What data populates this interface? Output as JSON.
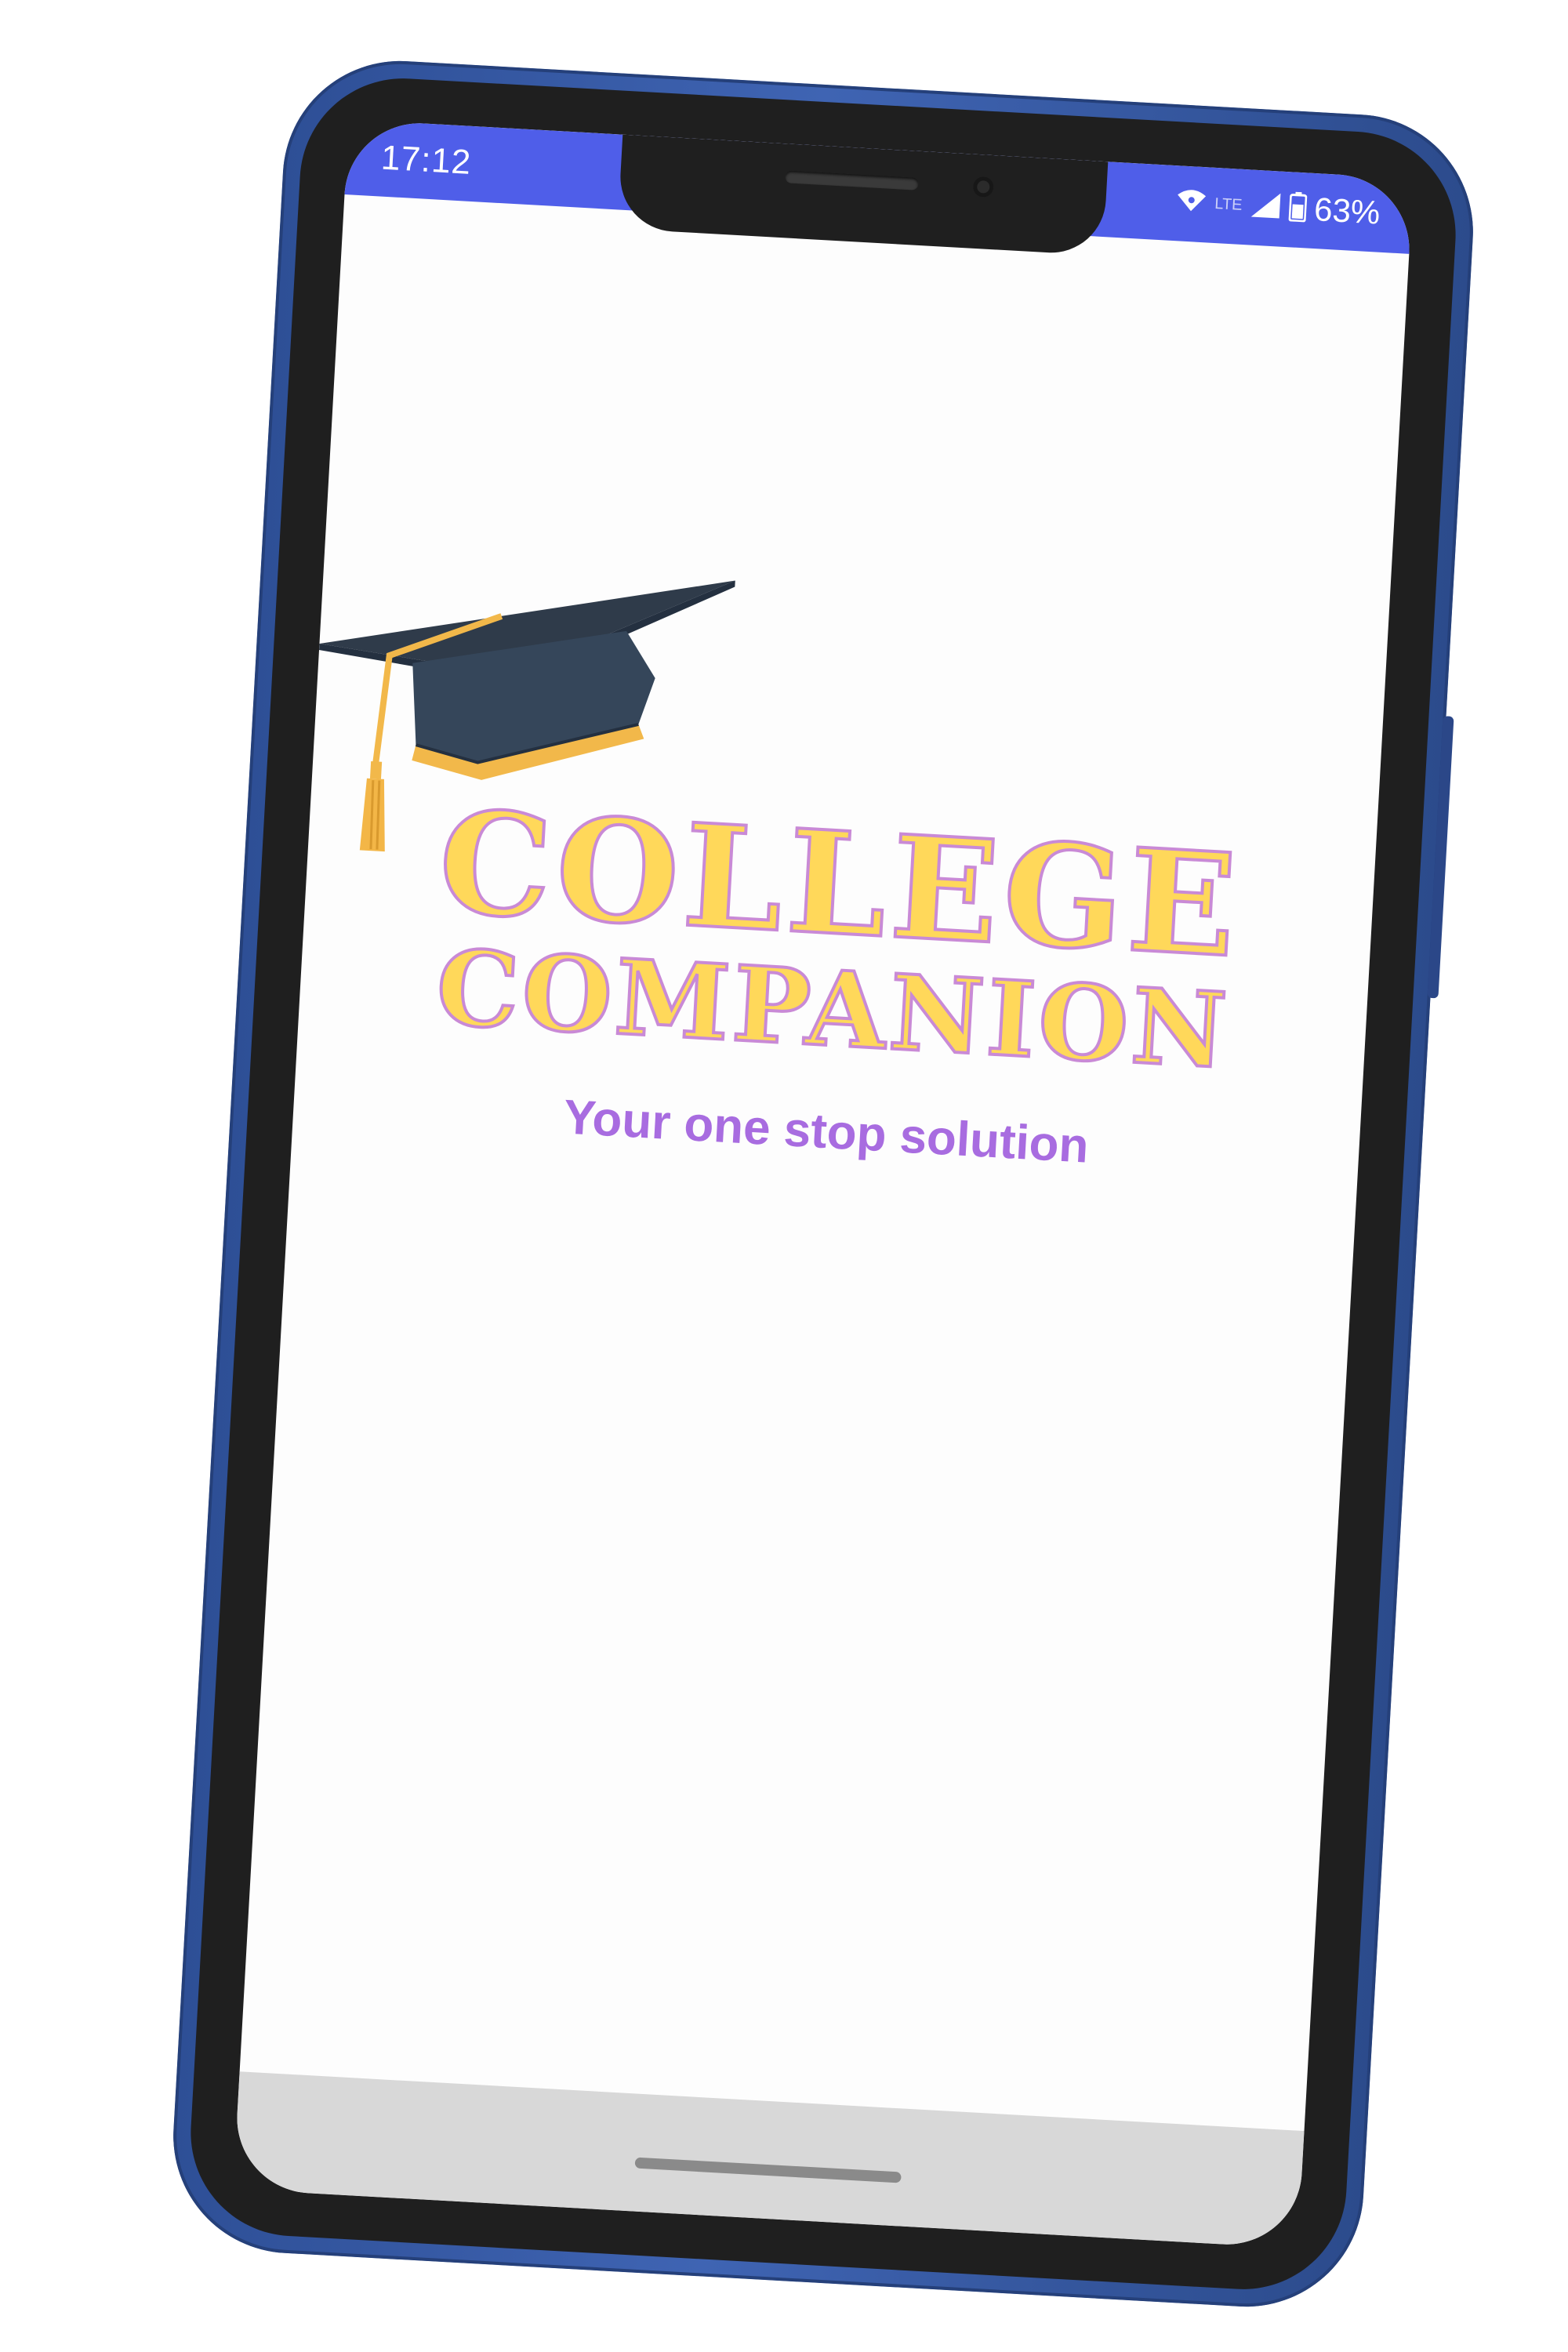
{
  "status_bar": {
    "time": "17:12",
    "network_label": "LTE",
    "battery_text": "63%",
    "background_color": "#4f5ee9"
  },
  "logo": {
    "line_1": "COLLEGE",
    "line_2": "COMPANION",
    "tagline": "Your one stop solution",
    "title_fill_color": "#ffd85a",
    "title_outline_color": "#c98ad6",
    "tagline_color": "#a86ce0"
  },
  "icons": {
    "cap": "graduation-cap-icon",
    "wifi": "wifi-icon",
    "signal": "cellular-signal-icon",
    "battery": "battery-icon"
  }
}
